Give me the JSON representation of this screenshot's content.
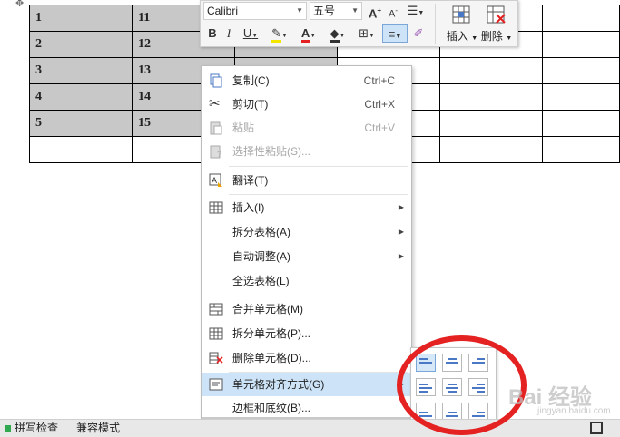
{
  "table": {
    "rows": [
      [
        "1",
        "11",
        "",
        "",
        "",
        ""
      ],
      [
        "2",
        "12",
        "",
        "",
        "",
        ""
      ],
      [
        "3",
        "13",
        "",
        "",
        "",
        ""
      ],
      [
        "4",
        "14",
        "",
        "",
        "",
        ""
      ],
      [
        "5",
        "15",
        "",
        "",
        "",
        ""
      ],
      [
        "",
        "",
        "",
        "",
        "",
        ""
      ]
    ]
  },
  "mini_toolbar": {
    "font_name": "Calibri",
    "font_size": "五号",
    "insert_label": "插入",
    "delete_label": "删除"
  },
  "context_menu": {
    "items": [
      {
        "label": "复制(C)",
        "shortcut": "Ctrl+C",
        "icon": "copy-icon"
      },
      {
        "label": "剪切(T)",
        "shortcut": "Ctrl+X",
        "icon": "scissors-icon"
      },
      {
        "label": "粘贴",
        "shortcut": "Ctrl+V",
        "icon": "paste-icon"
      },
      {
        "label": "选择性粘贴(S)...",
        "icon": "paste-special-icon"
      },
      {
        "label": "翻译(T)",
        "icon": "translate-icon"
      },
      {
        "label": "插入(I)",
        "icon": "table-icon"
      },
      {
        "label": "拆分表格(A)"
      },
      {
        "label": "自动调整(A)"
      },
      {
        "label": "全选表格(L)"
      },
      {
        "label": "合并单元格(M)",
        "icon": "merge-cells-icon"
      },
      {
        "label": "拆分单元格(P)...",
        "icon": "split-cells-icon"
      },
      {
        "label": "删除单元格(D)...",
        "icon": "delete-cells-icon"
      },
      {
        "label": "单元格对齐方式(G)",
        "icon": "cell-align-icon"
      },
      {
        "label": "边框和底纹(B)..."
      }
    ]
  },
  "statusbar": {
    "spell_check": "拼写检查",
    "compat_mode": "兼容模式"
  },
  "watermark": {
    "text": "Bai 经验",
    "sub": "jingyan.baidu.com"
  },
  "colors": {
    "highlight": "#cde3f7",
    "annotation": "#e52222",
    "align_icon": "#4a78c4"
  }
}
